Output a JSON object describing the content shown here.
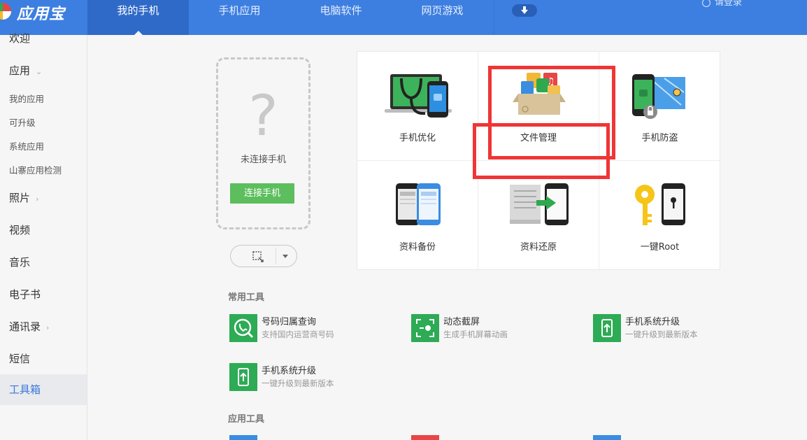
{
  "app": {
    "title": "应用宝"
  },
  "header": {
    "tabs": [
      {
        "label": "我的手机",
        "active": true
      },
      {
        "label": "手机应用",
        "active": false
      },
      {
        "label": "电脑软件",
        "active": false
      },
      {
        "label": "网页游戏",
        "active": false
      }
    ],
    "login_label": "请登录"
  },
  "sidebar": {
    "items": [
      {
        "label": "欢迎"
      },
      {
        "label": "应用",
        "chevron": "⌄"
      },
      {
        "label": "我的应用"
      },
      {
        "label": "可升级"
      },
      {
        "label": "系统应用"
      },
      {
        "label": "山寨应用检测"
      },
      {
        "label": "照片",
        "chevron": "›"
      },
      {
        "label": "视频"
      },
      {
        "label": "音乐"
      },
      {
        "label": "电子书"
      },
      {
        "label": "通讯录",
        "chevron": "›"
      },
      {
        "label": "短信"
      },
      {
        "label": "工具箱",
        "active": true
      }
    ]
  },
  "phone_panel": {
    "question_mark": "?",
    "status": "未连接手机",
    "connect_button": "连接手机"
  },
  "tiles": [
    {
      "label": "手机优化",
      "icon": "laptop-phone-stethoscope-icon"
    },
    {
      "label": "文件管理",
      "icon": "file-box-icon"
    },
    {
      "label": "手机防盗",
      "icon": "phone-lock-map-icon"
    },
    {
      "label": "资料备份",
      "icon": "dual-phone-icon"
    },
    {
      "label": "资料还原",
      "icon": "doc-to-phone-icon"
    },
    {
      "label": "一键Root",
      "icon": "key-phone-icon"
    }
  ],
  "common_tools": {
    "title": "常用工具",
    "items": [
      {
        "name": "号码归属查询",
        "desc": "支持国内运营商号码",
        "icon": "phone-search-icon"
      },
      {
        "name": "动态截屏",
        "desc": "生成手机屏幕动画",
        "icon": "screen-capture-icon"
      },
      {
        "name": "手机系统升级",
        "desc": "一键升级到最新版本",
        "icon": "phone-upgrade-icon"
      },
      {
        "name": "手机系统升级",
        "desc": "一键升级到最新版本",
        "icon": "phone-upgrade-icon"
      }
    ]
  },
  "app_tools": {
    "title": "应用工具"
  },
  "colors": {
    "accent": "#3d7fe0",
    "green": "#2dab55",
    "highlight": "#f03535"
  }
}
